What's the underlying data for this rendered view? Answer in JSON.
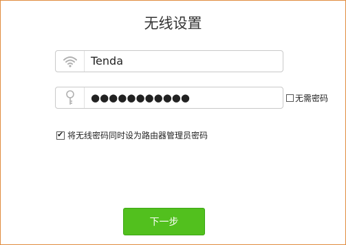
{
  "title": "无线设置",
  "ssid_field": {
    "value": "Tenda",
    "icon": "wifi-icon"
  },
  "password_field": {
    "value": "●●●●●●●●●●●",
    "icon": "key-icon"
  },
  "no_password": {
    "label": "无需密码",
    "checked": false
  },
  "same_as_admin": {
    "label": "将无线密码同时设为路由器管理员密码",
    "checked": true,
    "check_mark": "✔"
  },
  "next_button": {
    "label": "下一步"
  },
  "colors": {
    "accent": "#52c01e",
    "frame_border": "#e08a3c"
  }
}
